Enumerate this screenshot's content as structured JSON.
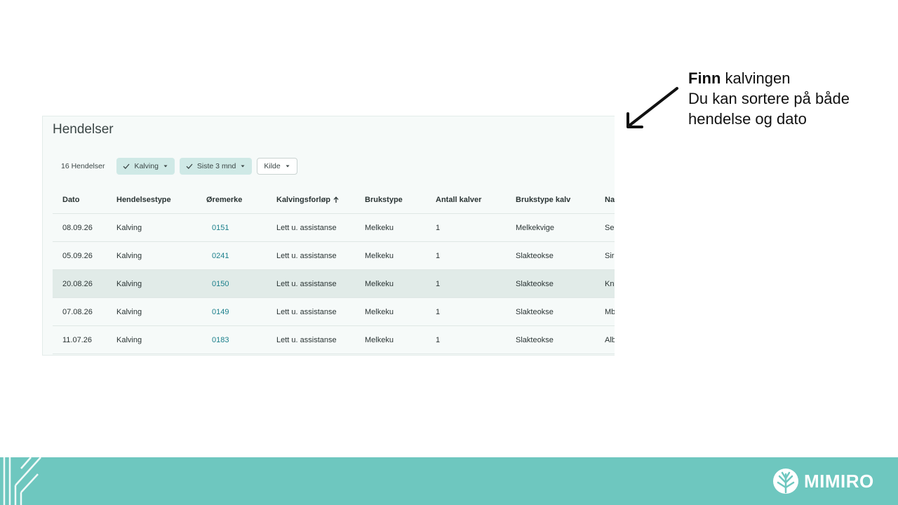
{
  "panel": {
    "title": "Hendelser",
    "count_label": "16 Hendelser",
    "filters": [
      {
        "label": "Kalving",
        "active": true
      },
      {
        "label": "Siste 3 mnd",
        "active": true
      },
      {
        "label": "Kilde",
        "active": false
      }
    ],
    "columns": [
      "Dato",
      "Hendelsestype",
      "Øremerke",
      "Kalvingsforløp",
      "Brukstype",
      "Antall kalver",
      "Brukstype kalv",
      "Na"
    ],
    "rows": [
      [
        "08.09.26",
        "Kalving",
        "0151",
        "Lett u. assistanse",
        "Melkeku",
        "1",
        "Melkekvige",
        "Se"
      ],
      [
        "05.09.26",
        "Kalving",
        "0241",
        "Lett u. assistanse",
        "Melkeku",
        "1",
        "Slakteokse",
        "Sir"
      ],
      [
        "20.08.26",
        "Kalving",
        "0150",
        "Lett u. assistanse",
        "Melkeku",
        "1",
        "Slakteokse",
        "Kn"
      ],
      [
        "07.08.26",
        "Kalving",
        "0149",
        "Lett u. assistanse",
        "Melkeku",
        "1",
        "Slakteokse",
        "Mb"
      ],
      [
        "11.07.26",
        "Kalving",
        "0183",
        "Lett u. assistanse",
        "Melkeku",
        "1",
        "Slakteokse",
        "Alb"
      ]
    ],
    "selected_row": 2,
    "sorted_column": "Kalvingsforløp",
    "sort_direction": "ascending",
    "sort_icon": "arrow-up-icon",
    "accent_color": "#1a7f8b",
    "chip_active_color": "#cfe9e6"
  },
  "annotation": {
    "line1_bold": "Finn",
    "line1_rest": " kalvingen",
    "line2": "Du kan sortere på både",
    "line3": "hendelse og dato",
    "arrow_icon": "arrow-down-left-icon"
  },
  "footer": {
    "brand": "MIMIRO",
    "logo_icon": "tree-logo-icon",
    "color": "#6ec7bf"
  }
}
